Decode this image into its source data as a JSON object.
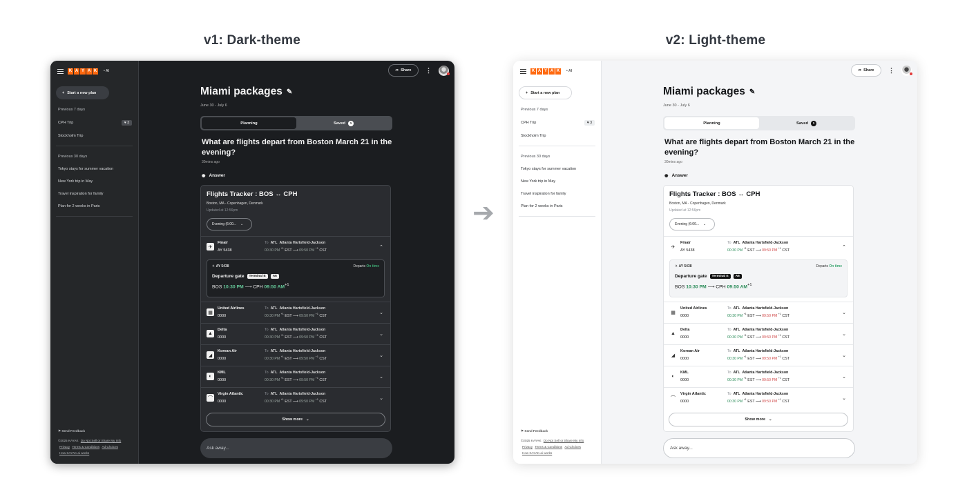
{
  "labels": {
    "v1": "v1: Dark-theme",
    "v2": "v2: Light-theme",
    "arrow": "➔"
  },
  "sidebar": {
    "logo_letters": [
      "K",
      "A",
      "Y",
      "A",
      "K"
    ],
    "ai_tag": "• AI",
    "new_plan": "Start a new plan",
    "section_7": "Previous 7 days",
    "items_7": [
      {
        "label": "CPH Trip",
        "badge": "♥ 3"
      },
      {
        "label": "Stockholm Trip"
      }
    ],
    "section_30": "Previous 30 days",
    "items_30": [
      {
        "label": "Tokyo stays for summer vacation"
      },
      {
        "label": "New York trip in May"
      },
      {
        "label": "Travel inspiration for family"
      },
      {
        "label": "Plan for 2 weeks in Paris"
      }
    ],
    "feedback": "Send Feedback",
    "copyright": "©2025 KAYAK",
    "dnsmi": "Do Not Sell or Share My Info",
    "privacy": "Privacy",
    "terms": "Terms & Conditions",
    "adchoices": "Ad Choices",
    "how": "How KAYAK.ai works"
  },
  "top": {
    "share": "Share"
  },
  "page": {
    "title": "Miami packages",
    "dates": "June 30 - July 6",
    "tab_planning": "Planning",
    "tab_saved": "Saved",
    "saved_count": "1",
    "question": "What are flights depart from Boston March 21 in the evening?",
    "ago": "30mins ago",
    "answer": "Answer"
  },
  "tracker": {
    "title": "Flights Tracker : BOS ↔ CPH",
    "subtitle": "Boston, MA - Copenhagen, Denmark",
    "updated": "Updated at 12:56pm",
    "filter": "Evening (6:00..."
  },
  "flights": [
    {
      "airline": "Finair",
      "code": "AY 5438",
      "logo": "✈",
      "to": "To",
      "dest_code": "ATL",
      "dest_name": "Atlanta Hartsfield-Jackson",
      "dep": "00:30 PM",
      "dep_tz": "EST",
      "arr": "09:50 PM",
      "arr_tz": "CST",
      "plus": "+1",
      "chevron": "⌃"
    },
    {
      "airline": "United Airlines",
      "code": "0000",
      "logo": "▦",
      "to": "To",
      "dest_code": "ATL",
      "dest_name": "Atlanta Hartsfield-Jackson",
      "dep": "00:30 PM",
      "dep_tz": "EST",
      "arr": "09:50 PM",
      "arr_tz": "CST",
      "plus": "+1",
      "chevron": "⌄"
    },
    {
      "airline": "Delta",
      "code": "0000",
      "logo": "▲",
      "to": "To",
      "dest_code": "ATL",
      "dest_name": "Atlanta Hartsfield-Jackson",
      "dep": "00:30 PM",
      "dep_tz": "EST",
      "arr": "09:50 PM",
      "arr_tz": "CST",
      "plus": "+1",
      "chevron": "⌄"
    },
    {
      "airline": "Korean Air",
      "code": "0000",
      "logo": "◢",
      "to": "To",
      "dest_code": "ATL",
      "dest_name": "Atlanta Hartsfield-Jackson",
      "dep": "00:30 PM",
      "dep_tz": "EST",
      "arr": "09:50 PM",
      "arr_tz": "CST",
      "plus": "+1",
      "chevron": "⌄"
    },
    {
      "airline": "KML",
      "code": "0000",
      "logo": "◐",
      "to": "To",
      "dest_code": "ATL",
      "dest_name": "Atlanta Hartsfield-Jackson",
      "dep": "00:30 PM",
      "dep_tz": "EST",
      "arr": "09:50 PM",
      "arr_tz": "CST",
      "plus": "+1",
      "chevron": "⌄"
    },
    {
      "airline": "Virgin Atlantic",
      "code": "0000",
      "logo": "⌒",
      "to": "To",
      "dest_code": "ATL",
      "dest_name": "Atlanta Hartsfield-Jackson",
      "dep": "00:30 PM",
      "dep_tz": "EST",
      "arr": "09:50 PM",
      "arr_tz": "CST",
      "plus": "+1",
      "chevron": "⌄"
    }
  ],
  "detail": {
    "code": "AY 5438",
    "departs": "Departs",
    "status": "On time",
    "gate_label": "Departure gate",
    "terminal": "Terminal E",
    "gate": "A6",
    "from": "BOS",
    "dep_time": "10:30 PM",
    "to": "CPH",
    "arr_time": "09:50 AM",
    "plus": "+1"
  },
  "show_more": "Show more",
  "ask_placeholder": "Ask away...",
  "colors": {
    "kayak_orange": "#ff690f",
    "on_time_green": "#3ea772",
    "arrival_red": "#d04a4a"
  }
}
